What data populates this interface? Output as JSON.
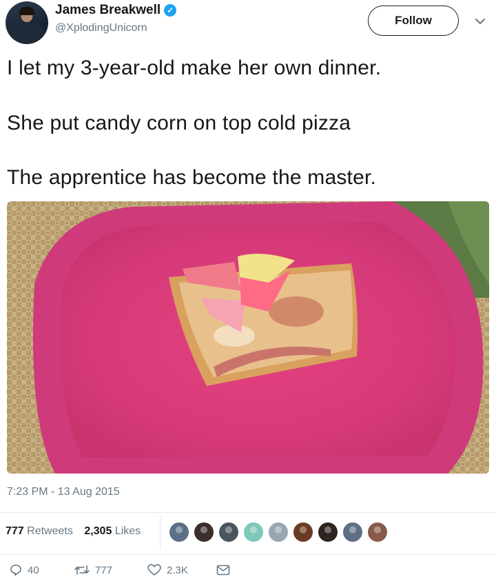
{
  "user": {
    "display_name": "James Breakwell",
    "handle": "@XplodingUnicorn",
    "verified_glyph": "✓",
    "avatar_icon": "user-avatar"
  },
  "follow_label": "Follow",
  "tweet": {
    "lines": [
      "I let my 3-year-old make her own dinner.",
      "She put candy corn on top cold pizza",
      "The apprentice has become the master."
    ]
  },
  "photo": {
    "icon": "photo-pizza-candy-corn-on-pink-plate"
  },
  "timestamp": "7:23 PM - 13 Aug 2015",
  "stats": {
    "retweets_count": "777",
    "retweets_label": "Retweets",
    "likes_count": "2,305",
    "likes_label": "Likes"
  },
  "liker_colors": [
    "#5b6f86",
    "#3b2f2b",
    "#4a5560",
    "#7fc8b9",
    "#9aa7b3",
    "#6a3b22",
    "#2d2420",
    "#5e6f85",
    "#8a5b4a"
  ],
  "actions": {
    "reply_count": "40",
    "retweet_count": "777",
    "like_count": "2.3K"
  },
  "colors": {
    "text": "#14171a",
    "secondary": "#657786",
    "verified": "#1da1f2",
    "divider": "#e1e8ed"
  }
}
